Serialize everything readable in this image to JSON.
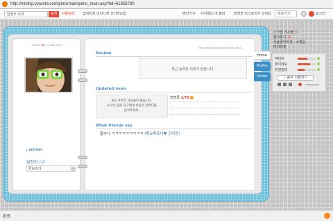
{
  "browser": {
    "url": "http://minihp.cyworld.com/pims/main/pims_main.asp?tid=61858780",
    "status": "완료"
  },
  "toolbar": {
    "search_value": "남궁두 사과",
    "search_button": "검색",
    "person_search": "사람검색",
    "links": [
      "앱자이게 건지니게 코디하는법",
      "메인가기",
      "사이월드 내 홈피",
      "방명한 미스프리가 남아요"
    ],
    "select_value": "바로가기",
    "login": "로그인"
  },
  "today": {
    "today_label": "TODAY",
    "today_value": "93",
    "total_label": "TOTAL",
    "total_value": "3127"
  },
  "profile": {
    "history_label": "HISTORY",
    "owner": "임진아",
    "owner_sex": "(♀)",
    "mood": "금도미기"
  },
  "homepage_url": "http://www.cyworld.com/29413441",
  "review": {
    "title": "Review",
    "message": "최근 등록된 리뷰가 없습니다."
  },
  "updated_news": {
    "title": "Updated news",
    "message": [
      "최근 #주간 게시물이 없습니다.",
      "소식이 뜸한 친구에게 마음의 한마디를",
      "남겨주세요."
    ]
  },
  "guestbook": {
    "label": "방명록",
    "count": "1/70"
  },
  "friends_say": {
    "title": "What friends say",
    "text": "잘수나 ㅋㅋㅋㅋㅋㅋㅋㅋㅋ",
    "who": "(목쇼파토너♥ 강다현)"
  },
  "tabs": [
    "Home",
    "Profile",
    "Visitor"
  ],
  "right_panel": {
    "lines": [
      "스크랩 게시물",
      "즐겨찾기",
      "서울좋아하세 · 소핑샵",
      "미이마켓"
    ],
    "counts": [
      "0",
      "24"
    ],
    "player": [
      "엑티버",
      "꽃이에요",
      "최현필리"
    ],
    "player_levels": [
      0.55,
      0.7,
      0.4
    ],
    "gift_button": "음악 선물하기"
  },
  "colors": {
    "accent": "#e0402f",
    "tab_blue": "#3c8fc6",
    "frame_blue": "#6cc0dc"
  }
}
